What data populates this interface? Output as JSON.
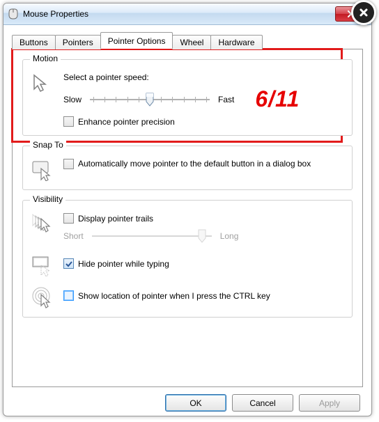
{
  "window": {
    "title": "Mouse Properties"
  },
  "tabs": {
    "buttons": "Buttons",
    "pointers": "Pointers",
    "pointer_options": "Pointer Options",
    "wheel": "Wheel",
    "hardware": "Hardware"
  },
  "motion": {
    "legend": "Motion",
    "select_label": "Select a pointer speed:",
    "slow": "Slow",
    "fast": "Fast",
    "speed_annotation": "6/11",
    "enhance": "Enhance pointer precision",
    "enhance_checked": false,
    "slider_value": 6,
    "slider_max": 11
  },
  "snap": {
    "legend": "Snap To",
    "label": "Automatically move pointer to the default button in a dialog box",
    "checked": false
  },
  "visibility": {
    "legend": "Visibility",
    "trails_label": "Display pointer trails",
    "trails_checked": false,
    "trails_short": "Short",
    "trails_long": "Long",
    "hide_label": "Hide pointer while typing",
    "hide_checked": true,
    "ctrl_label": "Show location of pointer when I press the CTRL key",
    "ctrl_checked": false
  },
  "buttons": {
    "ok": "OK",
    "cancel": "Cancel",
    "apply": "Apply"
  }
}
